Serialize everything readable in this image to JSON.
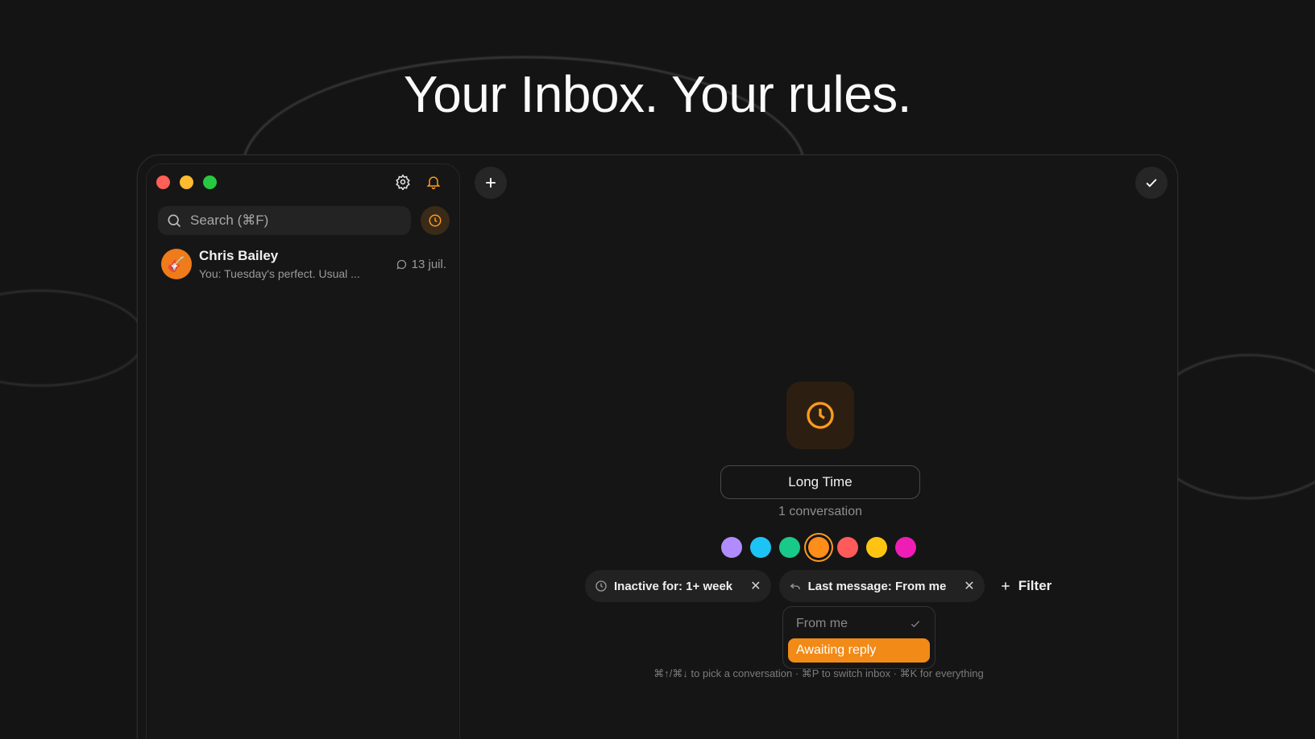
{
  "headline": "Your Inbox. Your rules.",
  "sidebar": {
    "search_placeholder": "Search (⌘F)",
    "conversations": [
      {
        "name": "Chris Bailey",
        "preview": "You: Tuesday's perfect. Usual ...",
        "date": "13 juil."
      }
    ]
  },
  "main": {
    "inbox_name": "Long Time",
    "conversation_count": "1 conversation",
    "colors": [
      "#b08cff",
      "#1cc4f5",
      "#19c98a",
      "#ff8d1a",
      "#ff5b5b",
      "#ffc412",
      "#ef1db5"
    ],
    "selected_color": "#ff8d1a",
    "filters": [
      {
        "label": "Inactive for: 1+ week",
        "icon": "clock-icon"
      },
      {
        "label": "Last message: From me",
        "icon": "reply-icon"
      }
    ],
    "add_filter_label": "Filter",
    "dropdown": {
      "options": [
        "From me",
        "Awaiting reply"
      ],
      "checked": "From me",
      "highlighted": "Awaiting reply"
    },
    "hint": "⌘↑/⌘↓ to pick a conversation · ⌘P to switch inbox · ⌘K for everything"
  }
}
